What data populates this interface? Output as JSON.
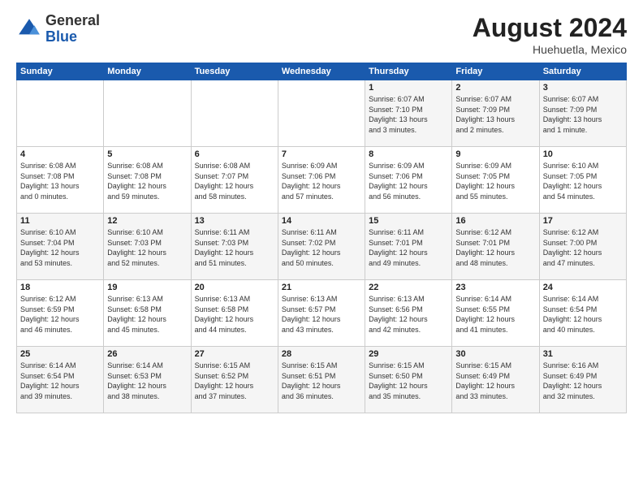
{
  "logo": {
    "general": "General",
    "blue": "Blue"
  },
  "header": {
    "month_year": "August 2024",
    "location": "Huehuetla, Mexico"
  },
  "weekdays": [
    "Sunday",
    "Monday",
    "Tuesday",
    "Wednesday",
    "Thursday",
    "Friday",
    "Saturday"
  ],
  "weeks": [
    [
      {
        "day": "",
        "info": ""
      },
      {
        "day": "",
        "info": ""
      },
      {
        "day": "",
        "info": ""
      },
      {
        "day": "",
        "info": ""
      },
      {
        "day": "1",
        "info": "Sunrise: 6:07 AM\nSunset: 7:10 PM\nDaylight: 13 hours\nand 3 minutes."
      },
      {
        "day": "2",
        "info": "Sunrise: 6:07 AM\nSunset: 7:09 PM\nDaylight: 13 hours\nand 2 minutes."
      },
      {
        "day": "3",
        "info": "Sunrise: 6:07 AM\nSunset: 7:09 PM\nDaylight: 13 hours\nand 1 minute."
      }
    ],
    [
      {
        "day": "4",
        "info": "Sunrise: 6:08 AM\nSunset: 7:08 PM\nDaylight: 13 hours\nand 0 minutes."
      },
      {
        "day": "5",
        "info": "Sunrise: 6:08 AM\nSunset: 7:08 PM\nDaylight: 12 hours\nand 59 minutes."
      },
      {
        "day": "6",
        "info": "Sunrise: 6:08 AM\nSunset: 7:07 PM\nDaylight: 12 hours\nand 58 minutes."
      },
      {
        "day": "7",
        "info": "Sunrise: 6:09 AM\nSunset: 7:06 PM\nDaylight: 12 hours\nand 57 minutes."
      },
      {
        "day": "8",
        "info": "Sunrise: 6:09 AM\nSunset: 7:06 PM\nDaylight: 12 hours\nand 56 minutes."
      },
      {
        "day": "9",
        "info": "Sunrise: 6:09 AM\nSunset: 7:05 PM\nDaylight: 12 hours\nand 55 minutes."
      },
      {
        "day": "10",
        "info": "Sunrise: 6:10 AM\nSunset: 7:05 PM\nDaylight: 12 hours\nand 54 minutes."
      }
    ],
    [
      {
        "day": "11",
        "info": "Sunrise: 6:10 AM\nSunset: 7:04 PM\nDaylight: 12 hours\nand 53 minutes."
      },
      {
        "day": "12",
        "info": "Sunrise: 6:10 AM\nSunset: 7:03 PM\nDaylight: 12 hours\nand 52 minutes."
      },
      {
        "day": "13",
        "info": "Sunrise: 6:11 AM\nSunset: 7:03 PM\nDaylight: 12 hours\nand 51 minutes."
      },
      {
        "day": "14",
        "info": "Sunrise: 6:11 AM\nSunset: 7:02 PM\nDaylight: 12 hours\nand 50 minutes."
      },
      {
        "day": "15",
        "info": "Sunrise: 6:11 AM\nSunset: 7:01 PM\nDaylight: 12 hours\nand 49 minutes."
      },
      {
        "day": "16",
        "info": "Sunrise: 6:12 AM\nSunset: 7:01 PM\nDaylight: 12 hours\nand 48 minutes."
      },
      {
        "day": "17",
        "info": "Sunrise: 6:12 AM\nSunset: 7:00 PM\nDaylight: 12 hours\nand 47 minutes."
      }
    ],
    [
      {
        "day": "18",
        "info": "Sunrise: 6:12 AM\nSunset: 6:59 PM\nDaylight: 12 hours\nand 46 minutes."
      },
      {
        "day": "19",
        "info": "Sunrise: 6:13 AM\nSunset: 6:58 PM\nDaylight: 12 hours\nand 45 minutes."
      },
      {
        "day": "20",
        "info": "Sunrise: 6:13 AM\nSunset: 6:58 PM\nDaylight: 12 hours\nand 44 minutes."
      },
      {
        "day": "21",
        "info": "Sunrise: 6:13 AM\nSunset: 6:57 PM\nDaylight: 12 hours\nand 43 minutes."
      },
      {
        "day": "22",
        "info": "Sunrise: 6:13 AM\nSunset: 6:56 PM\nDaylight: 12 hours\nand 42 minutes."
      },
      {
        "day": "23",
        "info": "Sunrise: 6:14 AM\nSunset: 6:55 PM\nDaylight: 12 hours\nand 41 minutes."
      },
      {
        "day": "24",
        "info": "Sunrise: 6:14 AM\nSunset: 6:54 PM\nDaylight: 12 hours\nand 40 minutes."
      }
    ],
    [
      {
        "day": "25",
        "info": "Sunrise: 6:14 AM\nSunset: 6:54 PM\nDaylight: 12 hours\nand 39 minutes."
      },
      {
        "day": "26",
        "info": "Sunrise: 6:14 AM\nSunset: 6:53 PM\nDaylight: 12 hours\nand 38 minutes."
      },
      {
        "day": "27",
        "info": "Sunrise: 6:15 AM\nSunset: 6:52 PM\nDaylight: 12 hours\nand 37 minutes."
      },
      {
        "day": "28",
        "info": "Sunrise: 6:15 AM\nSunset: 6:51 PM\nDaylight: 12 hours\nand 36 minutes."
      },
      {
        "day": "29",
        "info": "Sunrise: 6:15 AM\nSunset: 6:50 PM\nDaylight: 12 hours\nand 35 minutes."
      },
      {
        "day": "30",
        "info": "Sunrise: 6:15 AM\nSunset: 6:49 PM\nDaylight: 12 hours\nand 33 minutes."
      },
      {
        "day": "31",
        "info": "Sunrise: 6:16 AM\nSunset: 6:49 PM\nDaylight: 12 hours\nand 32 minutes."
      }
    ]
  ]
}
